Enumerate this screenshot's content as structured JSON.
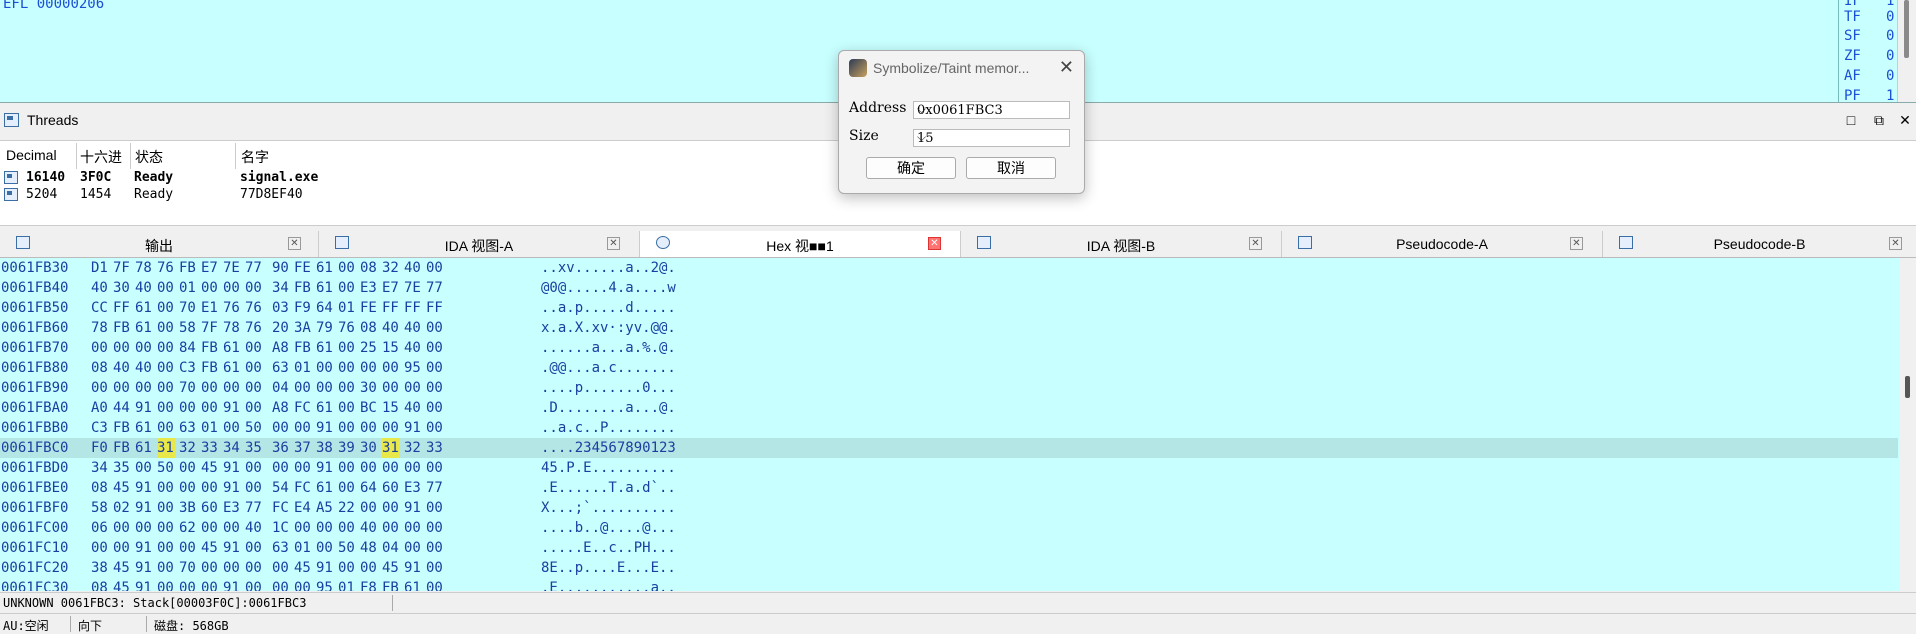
{
  "registers": {
    "efl_label": "EFL",
    "efl_value": "00000206",
    "flags": [
      {
        "name": "IF",
        "value": "1"
      },
      {
        "name": "TF",
        "value": "0"
      },
      {
        "name": "SF",
        "value": "0"
      },
      {
        "name": "ZF",
        "value": "0"
      },
      {
        "name": "AF",
        "value": "0"
      },
      {
        "name": "PF",
        "value": "1"
      }
    ]
  },
  "threads": {
    "title": "Threads",
    "headers": [
      "Decimal",
      "十六进",
      "状态",
      "名字"
    ],
    "rows": [
      {
        "decimal": "16140",
        "hex": "3F0C",
        "state": "Ready",
        "name": "signal.exe"
      },
      {
        "decimal": "5204",
        "hex": "1454",
        "state": "Ready",
        "name": "77D8EF40"
      }
    ],
    "controls": [
      "□",
      "⧉",
      "✕"
    ]
  },
  "tabs": [
    {
      "label": "输出",
      "close": "✕"
    },
    {
      "label": "IDA 视图-A",
      "close": "✕"
    },
    {
      "label": "Hex 视■■1",
      "close": "✕"
    },
    {
      "label": "IDA 视图-B",
      "close": "✕"
    },
    {
      "label": "Pseudocode-A",
      "close": "✕"
    },
    {
      "label": "Pseudocode-B",
      "close": "✕"
    }
  ],
  "hex": {
    "lines": [
      {
        "addr": "0061FB30",
        "bytes": [
          "D1",
          "7F",
          "78",
          "76",
          "FB",
          "E7",
          "7E",
          "77",
          "90",
          "FE",
          "61",
          "00",
          "08",
          "32",
          "40",
          "00"
        ],
        "ascii": "..xv......a..2@."
      },
      {
        "addr": "0061FB40",
        "bytes": [
          "40",
          "30",
          "40",
          "00",
          "01",
          "00",
          "00",
          "00",
          "34",
          "FB",
          "61",
          "00",
          "E3",
          "E7",
          "7E",
          "77"
        ],
        "ascii": "@0@.....4.a....w"
      },
      {
        "addr": "0061FB50",
        "bytes": [
          "CC",
          "FF",
          "61",
          "00",
          "70",
          "E1",
          "76",
          "76",
          "03",
          "F9",
          "64",
          "01",
          "FE",
          "FF",
          "FF",
          "FF"
        ],
        "ascii": "..a.p.....d....."
      },
      {
        "addr": "0061FB60",
        "bytes": [
          "78",
          "FB",
          "61",
          "00",
          "58",
          "7F",
          "78",
          "76",
          "20",
          "3A",
          "79",
          "76",
          "08",
          "40",
          "40",
          "00"
        ],
        "ascii": "x.a.X.xv·:yv.@@."
      },
      {
        "addr": "0061FB70",
        "bytes": [
          "00",
          "00",
          "00",
          "00",
          "84",
          "FB",
          "61",
          "00",
          "A8",
          "FB",
          "61",
          "00",
          "25",
          "15",
          "40",
          "00"
        ],
        "ascii": "......a...a.%.@."
      },
      {
        "addr": "0061FB80",
        "bytes": [
          "08",
          "40",
          "40",
          "00",
          "C3",
          "FB",
          "61",
          "00",
          "63",
          "01",
          "00",
          "00",
          "00",
          "00",
          "95",
          "00"
        ],
        "ascii": ".@@...a.c......."
      },
      {
        "addr": "0061FB90",
        "bytes": [
          "00",
          "00",
          "00",
          "00",
          "70",
          "00",
          "00",
          "00",
          "04",
          "00",
          "00",
          "00",
          "30",
          "00",
          "00",
          "00"
        ],
        "ascii": "....p.......0..."
      },
      {
        "addr": "0061FBA0",
        "bytes": [
          "A0",
          "44",
          "91",
          "00",
          "00",
          "00",
          "91",
          "00",
          "A8",
          "FC",
          "61",
          "00",
          "BC",
          "15",
          "40",
          "00"
        ],
        "ascii": ".D........a...@."
      },
      {
        "addr": "0061FBB0",
        "bytes": [
          "C3",
          "FB",
          "61",
          "00",
          "63",
          "01",
          "00",
          "50",
          "00",
          "00",
          "91",
          "00",
          "00",
          "00",
          "91",
          "00"
        ],
        "ascii": "..a.c..P........"
      },
      {
        "addr": "0061FBC0",
        "bytes": [
          "F0",
          "FB",
          "61",
          "31",
          "32",
          "33",
          "34",
          "35",
          "36",
          "37",
          "38",
          "39",
          "30",
          "31",
          "32",
          "33"
        ],
        "ascii": "....234567890123",
        "highlight": true,
        "yellow": [
          3,
          13
        ]
      },
      {
        "addr": "0061FBD0",
        "bytes": [
          "34",
          "35",
          "00",
          "50",
          "00",
          "45",
          "91",
          "00",
          "00",
          "00",
          "91",
          "00",
          "00",
          "00",
          "00",
          "00"
        ],
        "ascii": "45.P.E.........."
      },
      {
        "addr": "0061FBE0",
        "bytes": [
          "08",
          "45",
          "91",
          "00",
          "00",
          "00",
          "91",
          "00",
          "54",
          "FC",
          "61",
          "00",
          "64",
          "60",
          "E3",
          "77"
        ],
        "ascii": ".E......T.a.d`.."
      },
      {
        "addr": "0061FBF0",
        "bytes": [
          "58",
          "02",
          "91",
          "00",
          "3B",
          "60",
          "E3",
          "77",
          "FC",
          "E4",
          "A5",
          "22",
          "00",
          "00",
          "91",
          "00"
        ],
        "ascii": "X...;`.........."
      },
      {
        "addr": "0061FC00",
        "bytes": [
          "06",
          "00",
          "00",
          "00",
          "62",
          "00",
          "00",
          "40",
          "1C",
          "00",
          "00",
          "00",
          "40",
          "00",
          "00",
          "00"
        ],
        "ascii": "....b..@....@..."
      },
      {
        "addr": "0061FC10",
        "bytes": [
          "00",
          "00",
          "91",
          "00",
          "00",
          "45",
          "91",
          "00",
          "63",
          "01",
          "00",
          "50",
          "48",
          "04",
          "00",
          "00"
        ],
        "ascii": ".....E..c..PH..."
      },
      {
        "addr": "0061FC20",
        "bytes": [
          "38",
          "45",
          "91",
          "00",
          "70",
          "00",
          "00",
          "00",
          "00",
          "45",
          "91",
          "00",
          "00",
          "45",
          "91",
          "00"
        ],
        "ascii": "8E..p....E...E.."
      },
      {
        "addr": "0061FC30",
        "bytes": [
          "08",
          "45",
          "91",
          "00",
          "00",
          "00",
          "91",
          "00",
          "00",
          "00",
          "95",
          "01",
          "F8",
          "FB",
          "61",
          "00"
        ],
        "ascii": ".E...........a.."
      }
    ]
  },
  "hex_status": "UNKNOWN 0061FBC3: Stack[00003F0C]:0061FBC3",
  "statusbar": {
    "au": "AU:空闲",
    "direction": "向下",
    "disk": "磁盘: 568GB"
  },
  "dialog": {
    "title": "Symbolize/Taint memor...",
    "close": "✕",
    "address_label": "Address",
    "address_value": "0x0061FBC3",
    "size_label": "Size",
    "size_value": "15",
    "ok_label": "确定",
    "cancel_label": "取消",
    "arrow": "⌵"
  }
}
